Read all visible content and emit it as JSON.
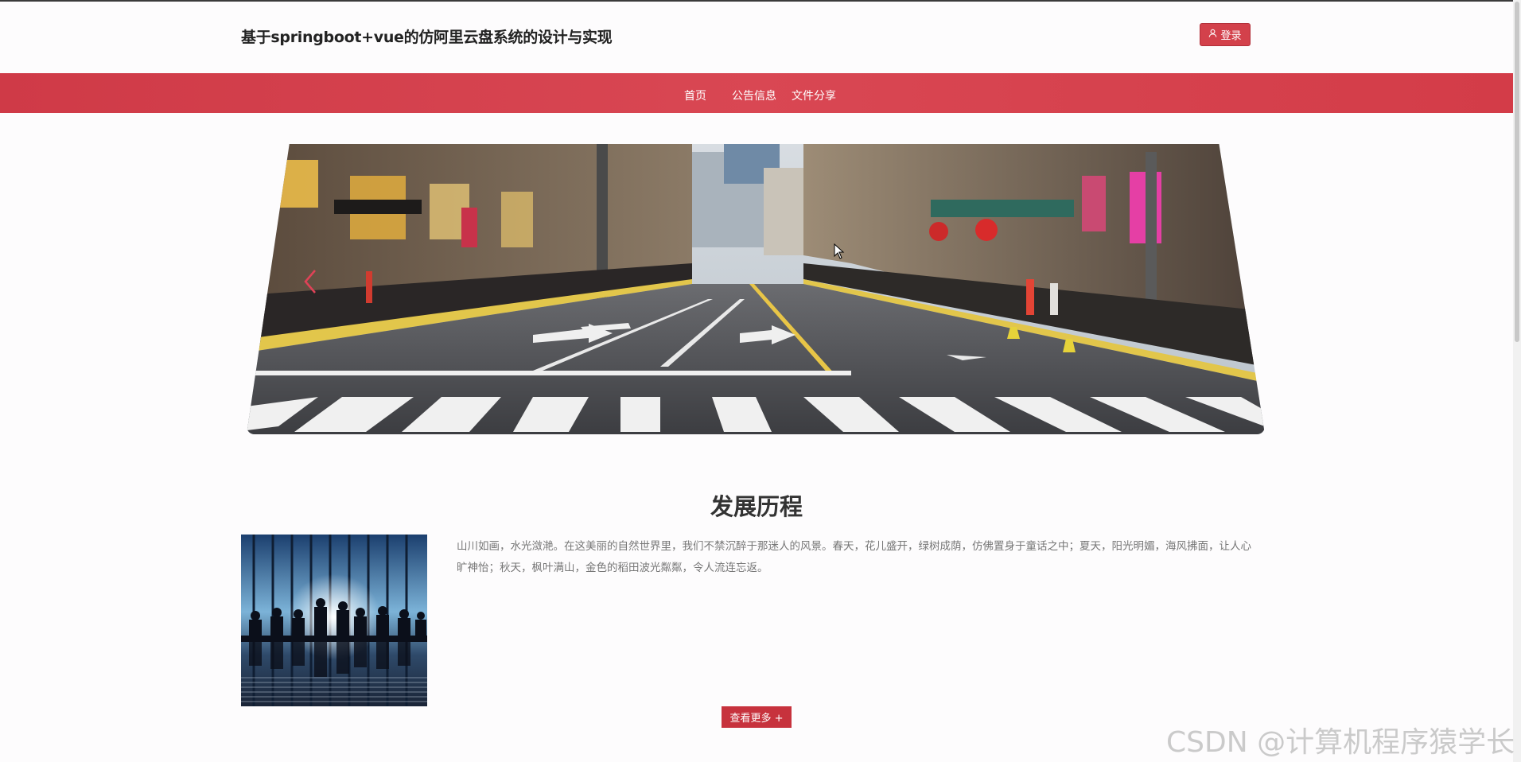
{
  "header": {
    "site_title": "基于springboot+vue的仿阿里云盘系统的设计与实现",
    "login_label": "登录",
    "login_icon": "user-icon"
  },
  "nav": {
    "items": [
      {
        "label": "首页"
      },
      {
        "label": "公告信息"
      },
      {
        "label": "文件分享"
      }
    ]
  },
  "section": {
    "title": "发展历程",
    "text": "山川如画，水光潋滟。在这美丽的自然世界里，我们不禁沉醉于那迷人的风景。春天，花儿盛开，绿树成荫，仿佛置身于童话之中；夏天，阳光明媚，海风拂面，让人心旷神怡；秋天，枫叶满山，金色的稻田波光粼粼，令人流连忘返。",
    "more_label": "查看更多 +"
  },
  "watermark": "CSDN @计算机程序猿学长",
  "colors": {
    "accent": "#d3414b",
    "nav_bg": "#d94753"
  }
}
